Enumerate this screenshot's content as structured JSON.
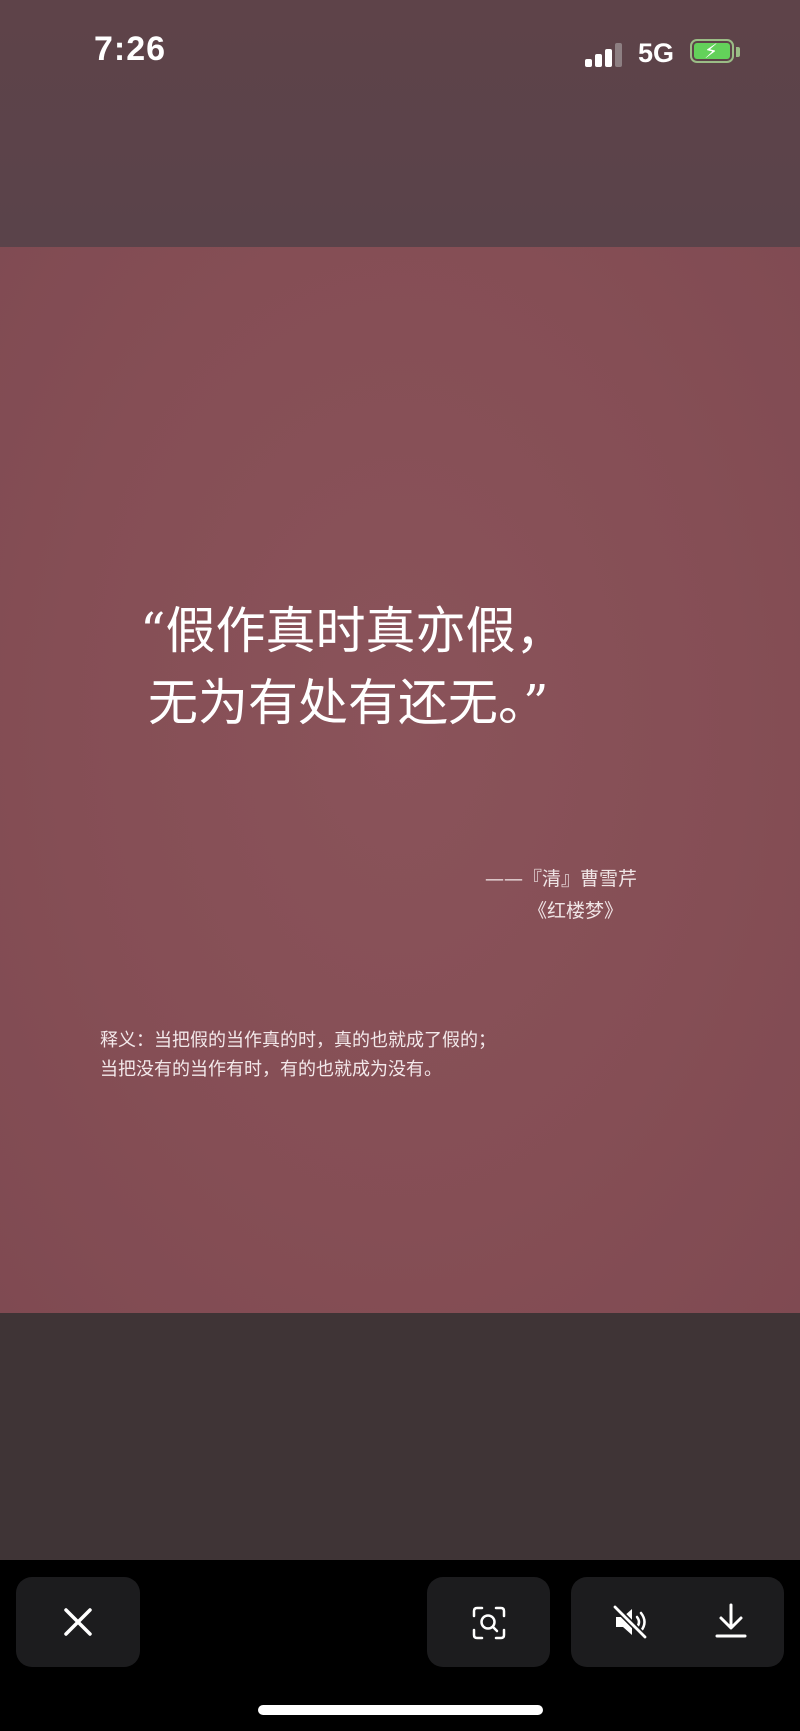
{
  "status_bar": {
    "time": "7:26",
    "network": "5G",
    "battery_icon": "battery-charging-icon",
    "signal_icon": "signal-icon"
  },
  "image": {
    "quote_line1": "“假作真时真亦假，",
    "quote_line2": "无为有处有还无。”",
    "author": "——『清』曹雪芹",
    "work": "《红楼梦》",
    "meaning_line1": "释义：当把假的当作真的时，真的也就成了假的；",
    "meaning_line2": "当把没有的当作有时，有的也就成为没有。"
  },
  "toolbar": {
    "close_icon": "close-icon",
    "lens_icon": "visual-search-icon",
    "mute_icon": "speaker-muted-icon",
    "download_icon": "download-icon"
  },
  "colors": {
    "image_bg": "#854e55",
    "top_bg": "#5e4349",
    "lower_bg": "#3f3436",
    "toolbar_bg": "#000000",
    "button_bg": "#1c1c1e"
  }
}
